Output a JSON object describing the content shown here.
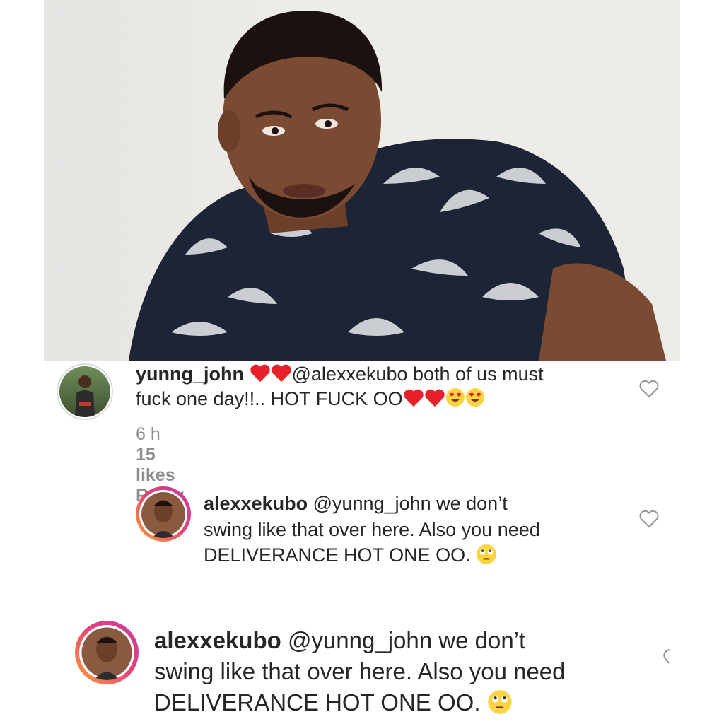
{
  "comments": [
    {
      "username": "yunng_john",
      "text_after_hearts": "@alexxekubo both of us must",
      "line2_text": "fuck one day!!.. HOT FUCK OO",
      "emoji": [
        "red-heart",
        "red-heart",
        "heart-eyes",
        "heart-eyes"
      ],
      "time": "6 h",
      "likes": "15 likes",
      "reply": "Reply"
    },
    {
      "username": "alexxekubo",
      "line1": "@yunng_john we don’t",
      "line2": "swing like that over here. Also you need",
      "line3": "DELIVERANCE HOT ONE OO.",
      "emoji": "eye-roll"
    },
    {
      "username": "alexxekubo",
      "line1": "@yunng_john we don’t",
      "line2": "swing like that over here. Also you need",
      "line3": "DELIVERANCE HOT ONE OO.",
      "emoji": "eye-roll"
    }
  ],
  "colors": {
    "text": "#262626",
    "meta": "#8e8e8e",
    "heart": "#e8202a",
    "emoji": "#fcd43f"
  }
}
